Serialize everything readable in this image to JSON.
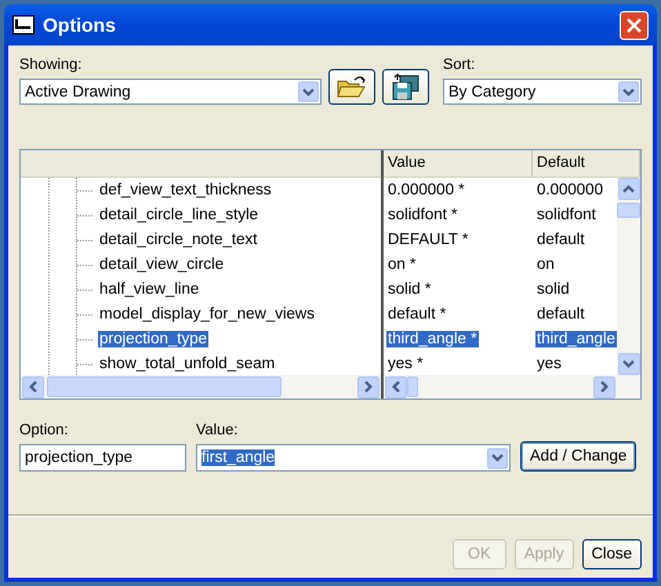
{
  "window": {
    "title": "Options"
  },
  "showing": {
    "label": "Showing:",
    "value": "Active Drawing"
  },
  "sort": {
    "label": "Sort:",
    "value": "By Category"
  },
  "table": {
    "columns": [
      "Value",
      "Default"
    ],
    "rows": [
      {
        "option": "def_view_text_thickness",
        "value": "0.000000 *",
        "default": "0.000000",
        "selected": false
      },
      {
        "option": "detail_circle_line_style",
        "value": "solidfont *",
        "default": "solidfont",
        "selected": false
      },
      {
        "option": "detail_circle_note_text",
        "value": "DEFAULT *",
        "default": "default",
        "selected": false
      },
      {
        "option": "detail_view_circle",
        "value": "on *",
        "default": "on",
        "selected": false
      },
      {
        "option": "half_view_line",
        "value": "solid *",
        "default": "solid",
        "selected": false
      },
      {
        "option": "model_display_for_new_views",
        "value": "default *",
        "default": "default",
        "selected": false
      },
      {
        "option": "projection_type",
        "value": "third_angle *",
        "default": "third_angle",
        "selected": true
      },
      {
        "option": "show_total_unfold_seam",
        "value": "yes *",
        "default": "yes",
        "selected": false
      }
    ]
  },
  "editor": {
    "option_label": "Option:",
    "option": "projection_type",
    "value_label": "Value:",
    "value": "first_angle",
    "button": "Add / Change"
  },
  "buttons": [
    {
      "label": "OK",
      "disabled": true
    },
    {
      "label": "Apply",
      "disabled": true
    },
    {
      "label": "Close",
      "disabled": false
    }
  ]
}
